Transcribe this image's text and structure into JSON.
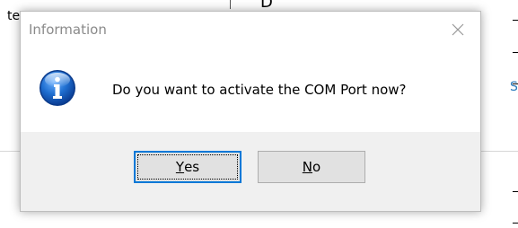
{
  "background": {
    "fragment_left": "te",
    "fragment_right": "S",
    "fragment_top": "D"
  },
  "dialog": {
    "title": "Information",
    "message": "Do you want to activate the COM Port now?",
    "icon": "info-icon",
    "buttons": {
      "yes": {
        "mnemonic": "Y",
        "rest": "es"
      },
      "no": {
        "mnemonic": "N",
        "rest": "o"
      }
    }
  }
}
